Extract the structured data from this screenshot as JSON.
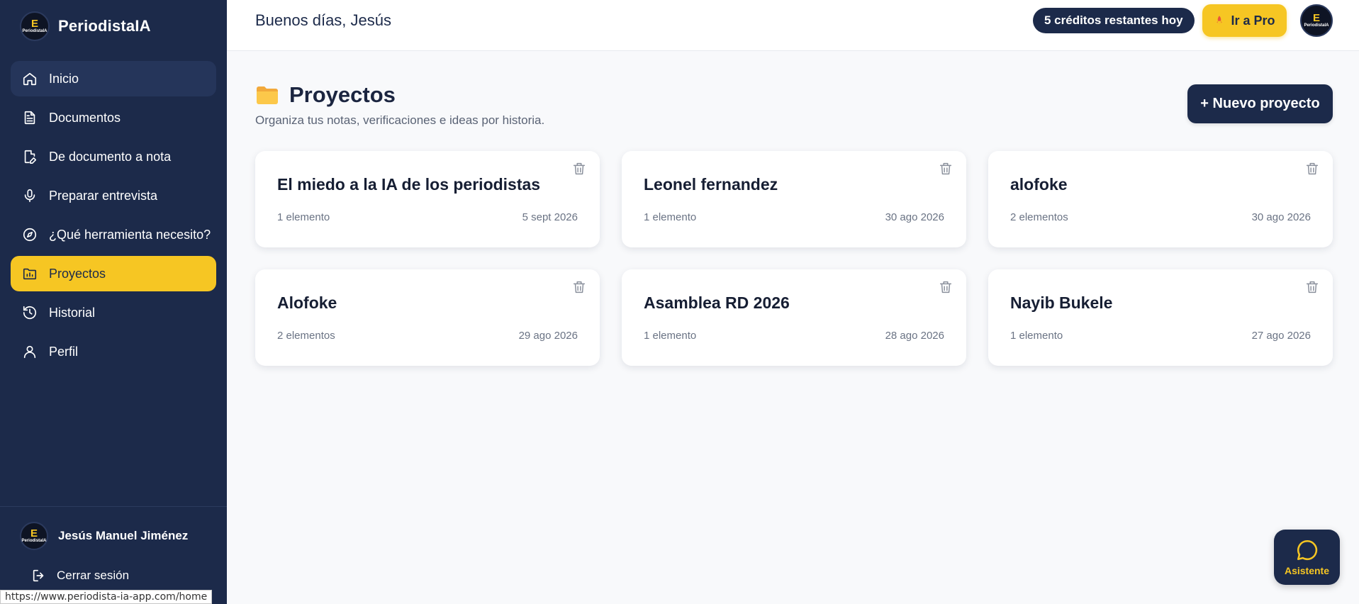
{
  "brand": {
    "name": "PeriodistaIA",
    "logo_mini": "PeriodistaIA"
  },
  "colors": {
    "sidebar": "#1c2a4a",
    "accent": "#f6c623",
    "background": "#f8f9fb"
  },
  "sidebar": {
    "items": [
      {
        "label": "Inicio",
        "icon": "home-icon"
      },
      {
        "label": "Documentos",
        "icon": "document-icon"
      },
      {
        "label": "De documento a nota",
        "icon": "document-edit-icon"
      },
      {
        "label": "Preparar entrevista",
        "icon": "microphone-icon"
      },
      {
        "label": "¿Qué herramienta necesito?",
        "icon": "compass-icon"
      },
      {
        "label": "Proyectos",
        "icon": "folder-chart-icon",
        "active": true
      },
      {
        "label": "Historial",
        "icon": "history-icon"
      },
      {
        "label": "Perfil",
        "icon": "user-icon"
      }
    ],
    "user_name": "Jesús Manuel Jiménez",
    "logout_label": "Cerrar sesión"
  },
  "status_url": "https://www.periodista-ia-app.com/home",
  "header": {
    "greeting": "Buenos días, Jesús",
    "credits": "5 créditos restantes hoy",
    "pro_label": "Ir a Pro"
  },
  "main": {
    "title": "Proyectos",
    "subtitle": "Organiza tus notas, verificaciones e ideas por historia.",
    "new_project_label": "+ Nuevo proyecto",
    "projects": [
      {
        "title": "El miedo a la IA de los periodistas",
        "count": "1 elemento",
        "date": "5 sept 2026"
      },
      {
        "title": "Leonel fernandez",
        "count": "1 elemento",
        "date": "30 ago 2026"
      },
      {
        "title": "alofoke",
        "count": "2 elementos",
        "date": "30 ago 2026"
      },
      {
        "title": "Alofoke",
        "count": "2 elementos",
        "date": "29 ago 2026"
      },
      {
        "title": "Asamblea RD 2026",
        "count": "1 elemento",
        "date": "28 ago 2026"
      },
      {
        "title": "Nayib Bukele",
        "count": "1 elemento",
        "date": "27 ago 2026"
      }
    ]
  },
  "assistant": {
    "label": "Asistente"
  }
}
